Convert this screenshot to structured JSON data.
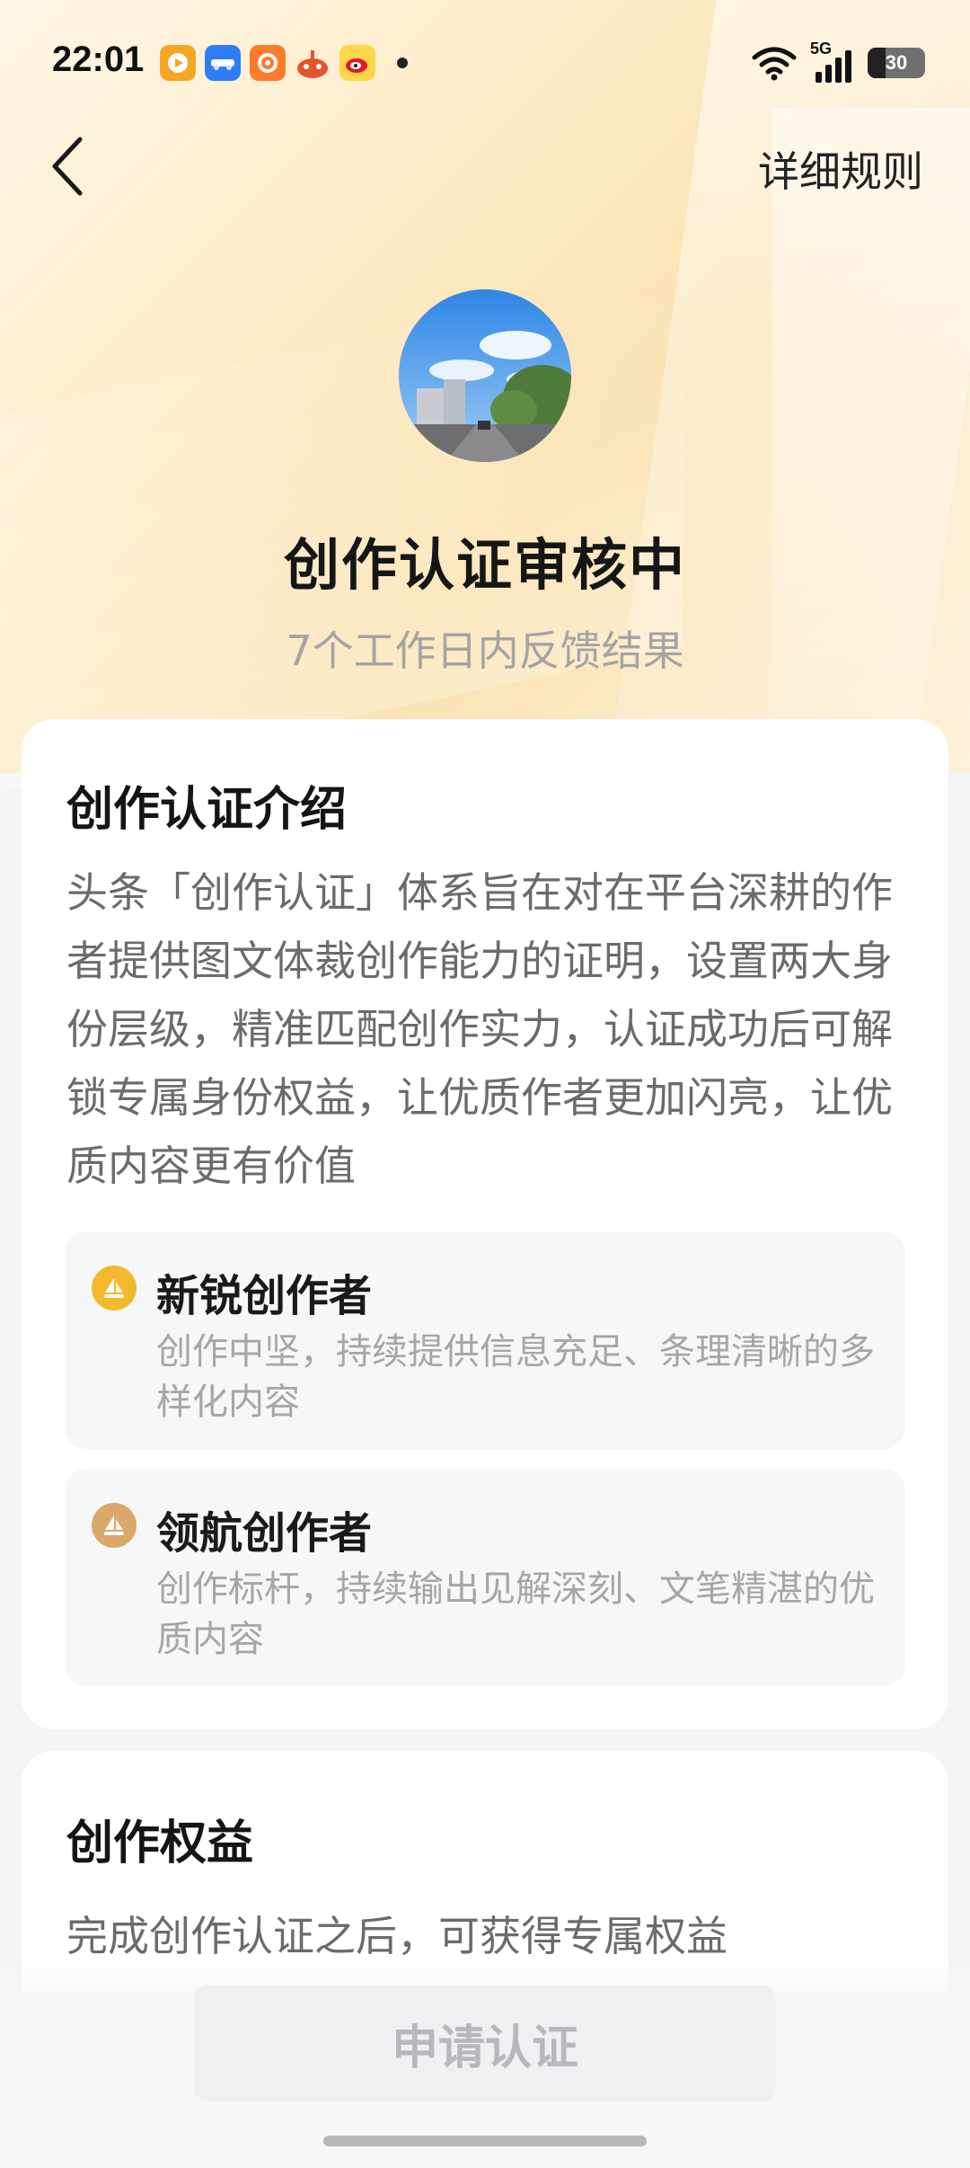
{
  "status_bar": {
    "time": "22:01",
    "network": "5G",
    "battery": "30",
    "notification_apps": [
      "video-app-icon",
      "car-news-app-icon",
      "browser-app-icon",
      "game-app-icon",
      "weibo-app-icon"
    ]
  },
  "nav": {
    "back_icon": "chevron-left-icon",
    "rules_label": "详细规则"
  },
  "hero": {
    "title": "创作认证审核中",
    "subtitle": "7个工作日内反馈结果"
  },
  "intro": {
    "title": "创作认证介绍",
    "text": "头条「创作认证」体系旨在对在平台深耕的作者提供图文体裁创作能力的证明，设置两大身份层级，精准匹配创作实力，认证成功后可解锁专属身份权益，让优质作者更加闪亮，让优质内容更有价值",
    "tiers": [
      {
        "name": "新锐创作者",
        "desc": "创作中坚，持续提供信息充足、条理清晰的多样化内容",
        "icon": "sail-badge-gold-icon",
        "color": "#f3b92c"
      },
      {
        "name": "领航创作者",
        "desc": "创作标杆，持续输出见解深刻、文笔精湛的优质内容",
        "icon": "sail-badge-bronze-icon",
        "color": "#d9a86a"
      }
    ]
  },
  "benefits": {
    "title": "创作权益",
    "text": "完成创作认证之后，可获得专属权益"
  },
  "footer": {
    "apply_label": "申请认证"
  }
}
